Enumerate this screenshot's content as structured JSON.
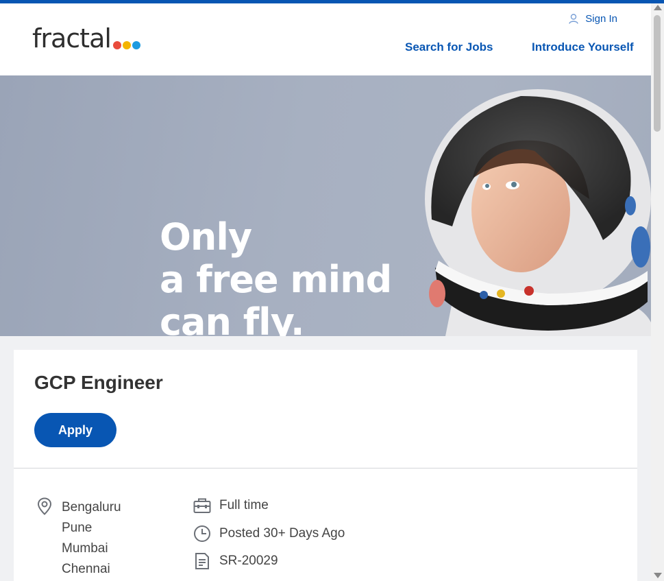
{
  "brand": {
    "logo_text": "fractal",
    "logo_dot_colors": [
      "#e94b3c",
      "#f4b400",
      "#1e9be0"
    ]
  },
  "header": {
    "sign_in": "Sign In",
    "nav": {
      "search_jobs": "Search for Jobs",
      "introduce_yourself": "Introduce Yourself"
    }
  },
  "hero": {
    "lines": [
      "Only",
      "a free mind",
      "can fly."
    ]
  },
  "job": {
    "title": "GCP Engineer",
    "apply_label": "Apply",
    "locations": [
      "Bengaluru",
      "Pune",
      "Mumbai",
      "Chennai"
    ],
    "time_type": "Full time",
    "posted": "Posted 30+ Days Ago",
    "req_id": "SR-20029"
  },
  "colors": {
    "accent": "#0856b3",
    "page_bg": "#f0f1f3"
  },
  "icons": [
    "user-icon",
    "location-pin-icon",
    "briefcase-icon",
    "clock-icon",
    "document-icon"
  ]
}
